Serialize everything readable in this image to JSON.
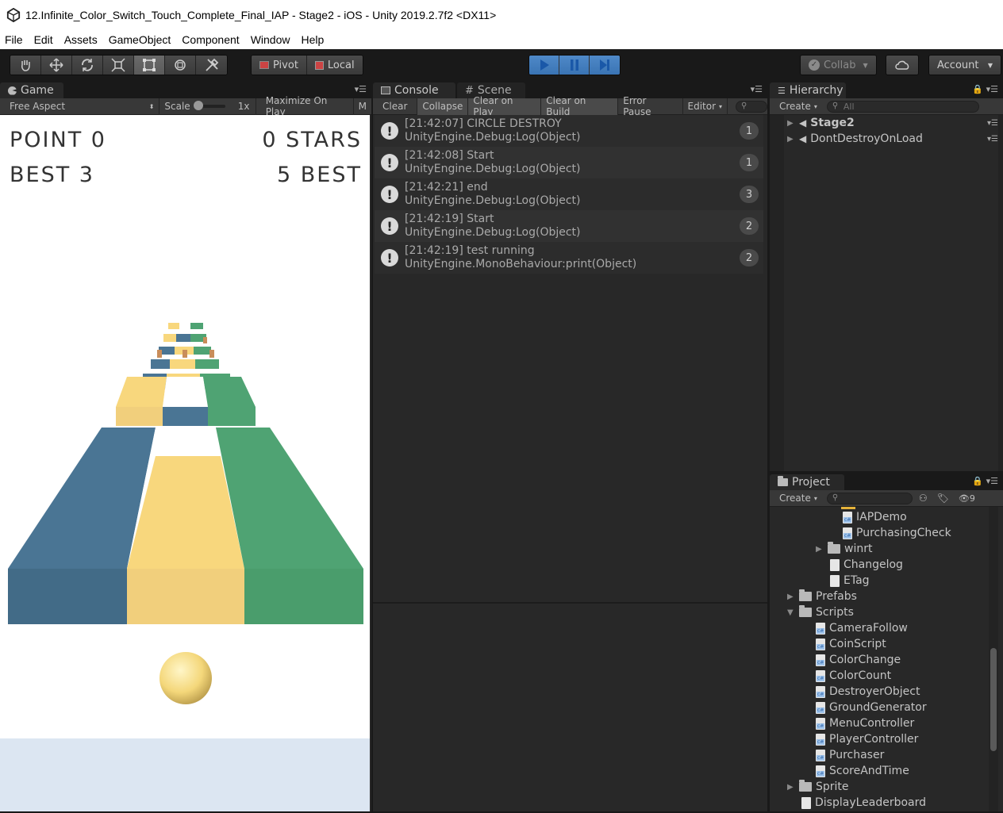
{
  "window": {
    "title": "12.Infinite_Color_Switch_Touch_Complete_Final_IAP - Stage2 - iOS - Unity 2019.2.7f2 <DX11>"
  },
  "menu": [
    "File",
    "Edit",
    "Assets",
    "GameObject",
    "Component",
    "Window",
    "Help"
  ],
  "toolbar": {
    "pivot": "Pivot",
    "local": "Local",
    "collab": "Collab",
    "account": "Account"
  },
  "game": {
    "tab": "Game",
    "aspect": "Free Aspect",
    "scale_label": "Scale",
    "scale_value": "1x",
    "maximize": "Maximize On Play",
    "m": "M",
    "point": "POINT 0",
    "stars": "0 STARS",
    "best_left": "BEST 3",
    "best_right": "5 BEST"
  },
  "console": {
    "tab": "Console",
    "scene_tab": "Scene",
    "buttons": [
      "Clear",
      "Collapse",
      "Clear on Play",
      "Clear on Build",
      "Error Pause",
      "Editor"
    ],
    "logs": [
      {
        "line1": "[21:42:07] CIRCLE DESTROY",
        "line2": "UnityEngine.Debug:Log(Object)",
        "count": "1"
      },
      {
        "line1": "[21:42:08] Start",
        "line2": "UnityEngine.Debug:Log(Object)",
        "count": "1"
      },
      {
        "line1": "[21:42:21] end",
        "line2": "UnityEngine.Debug:Log(Object)",
        "count": "3"
      },
      {
        "line1": "[21:42:19] Start",
        "line2": "UnityEngine.Debug:Log(Object)",
        "count": "2"
      },
      {
        "line1": "[21:42:19] test running",
        "line2": "UnityEngine.MonoBehaviour:print(Object)",
        "count": "2"
      }
    ]
  },
  "hierarchy": {
    "tab": "Hierarchy",
    "create": "Create",
    "search_placeholder": "All",
    "items": [
      "Stage2",
      "DontDestroyOnLoad"
    ]
  },
  "project": {
    "tab": "Project",
    "create": "Create",
    "hidden_count": "9",
    "items": [
      {
        "label": "IAPDemo",
        "type": "cs"
      },
      {
        "label": "PurchasingCheck",
        "type": "cs"
      },
      {
        "label": "winrt",
        "type": "folder"
      },
      {
        "label": "Changelog",
        "type": "txt"
      },
      {
        "label": "ETag",
        "type": "txt"
      },
      {
        "label": "Prefabs",
        "type": "folder"
      },
      {
        "label": "Scripts",
        "type": "folder"
      },
      {
        "label": "CameraFollow",
        "type": "cs"
      },
      {
        "label": "CoinScript",
        "type": "cs"
      },
      {
        "label": "ColorChange",
        "type": "cs"
      },
      {
        "label": "ColorCount",
        "type": "cs"
      },
      {
        "label": "DestroyerObject",
        "type": "cs"
      },
      {
        "label": "GroundGenerator",
        "type": "cs"
      },
      {
        "label": "MenuController",
        "type": "cs"
      },
      {
        "label": "PlayerController",
        "type": "cs"
      },
      {
        "label": "Purchaser",
        "type": "cs"
      },
      {
        "label": "ScoreAndTime",
        "type": "cs"
      },
      {
        "label": "Sprite",
        "type": "folder"
      },
      {
        "label": "DisplayLeaderboard",
        "type": "txt"
      }
    ]
  },
  "colors": {
    "blue": "#4a7594",
    "yellow": "#f8d77d",
    "green": "#4fa373",
    "play_active": "#3a74b4"
  }
}
